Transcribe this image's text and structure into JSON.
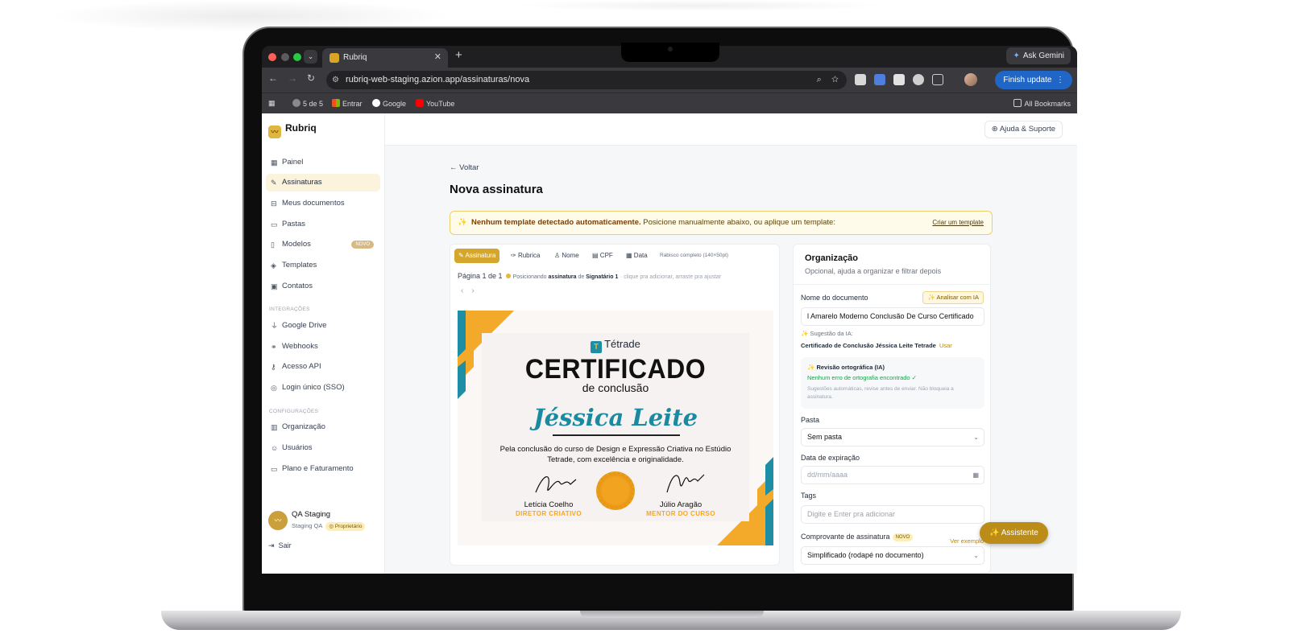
{
  "browser": {
    "tab_title": "Rubriq",
    "new_tab": "+",
    "close_tab": "✕",
    "ask_gemini": "Ask Gemini",
    "url": "rubriq-web-staging.azion.app/assinaturas/nova",
    "finish_update": "Finish update",
    "bookmarks": [
      "5 de 5",
      "Entrar",
      "Google",
      "YouTube"
    ],
    "all_bookmarks": "All Bookmarks"
  },
  "app": {
    "brand": "Rubriq",
    "help": "Ajuda & Suporte"
  },
  "sidebar": {
    "items": [
      {
        "label": "Painel",
        "icon": "grid-icon"
      },
      {
        "label": "Assinaturas",
        "icon": "sign-icon"
      },
      {
        "label": "Meus documentos",
        "icon": "inbox-icon"
      },
      {
        "label": "Pastas",
        "icon": "folder-icon"
      },
      {
        "label": "Modelos",
        "icon": "file-icon",
        "badge": "NOVO"
      },
      {
        "label": "Templates",
        "icon": "layers-icon"
      },
      {
        "label": "Contatos",
        "icon": "contact-icon"
      }
    ],
    "integrations_header": "INTEGRAÇÕES",
    "integrations": [
      {
        "label": "Google Drive",
        "icon": "plug-icon"
      },
      {
        "label": "Webhooks",
        "icon": "webhook-icon"
      },
      {
        "label": "Acesso API",
        "icon": "key-icon"
      },
      {
        "label": "Login único (SSO)",
        "icon": "fingerprint-icon"
      }
    ],
    "config_header": "CONFIGURAÇÕES",
    "config": [
      {
        "label": "Organização",
        "icon": "building-icon"
      },
      {
        "label": "Usuários",
        "icon": "users-icon"
      },
      {
        "label": "Plano e Faturamento",
        "icon": "card-icon"
      }
    ],
    "user": {
      "name": "QA Staging",
      "org": "Staging QA",
      "role": "Proprietário"
    },
    "logout": "Sair"
  },
  "main": {
    "back": "Voltar",
    "title": "Nova assinatura",
    "alert_bold": "Nenhum template detectado automaticamente.",
    "alert_text": "Posicione manualmente abaixo, ou aplique um template:",
    "alert_link": "Criar um template"
  },
  "editor": {
    "tools": [
      "Assinatura",
      "Rubrica",
      "Nome",
      "CPF",
      "Data"
    ],
    "tool_hint": "Rabisco completo (140×50pt)",
    "page": "Página 1 de 1",
    "pos_prefix": "Posicionando",
    "pos_field": "assinatura",
    "pos_mid": "de",
    "pos_signer": "Signatário 1",
    "pos_hint": "· clique pra adicionar, arraste pra ajustar"
  },
  "certificate": {
    "brand": "Tétrade",
    "title": "CERTIFICADO",
    "subtitle": "de conclusão",
    "name": "Jéssica Leite",
    "body": "Pela conclusão do curso de Design e Expressão Criativa no Estúdio Tetrade, com excelência e originalidade.",
    "signer1_name": "Letícia Coelho",
    "signer1_role": "DIRETOR CRIATIVO",
    "signer2_name": "Júlio Aragão",
    "signer2_role": "MENTOR DO CURSO"
  },
  "org_panel": {
    "title": "Organização",
    "subtitle": "Opcional, ajuda a organizar e filtrar depois",
    "doc_name_label": "Nome do documento",
    "ai_button": "Analisar com IA",
    "doc_name_value": "l Amarelo Moderno Conclusão De Curso Certificado",
    "suggestion_label": "Sugestão da IA:",
    "suggestion_value": "Certificado de Conclusão Jéssica Leite Tetrade",
    "suggestion_use": "Usar",
    "review_title": "Revisão ortográfica (IA)",
    "review_ok": "Nenhum erro de ortografia encontrado ✓",
    "review_note": "Sugestões automáticas, revise antes de enviar. Não bloqueia a assinatura.",
    "folder_label": "Pasta",
    "folder_value": "Sem pasta",
    "expiry_label": "Data de expiração",
    "expiry_placeholder": "dd/mm/aaaa",
    "tags_label": "Tags",
    "tags_placeholder": "Digite e Enter pra adicionar",
    "receipt_label": "Comprovante de assinatura",
    "receipt_badge": "NOVO",
    "receipt_example": "Ver exemplo",
    "receipt_value": "Simplificado (rodapé no documento)"
  },
  "assistant": "Assistente"
}
